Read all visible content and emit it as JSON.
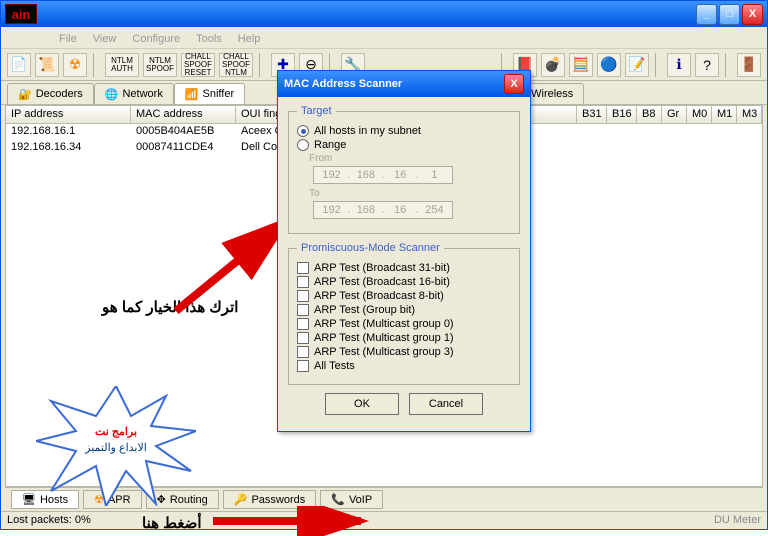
{
  "logo": "ain",
  "window_buttons": {
    "min": "_",
    "max": "□",
    "close": "X"
  },
  "menu": [
    "File",
    "View",
    "Configure",
    "Tools",
    "Help"
  ],
  "toolbar_text_btns": [
    "NTLM\nAUTH",
    "NTLM\nSPOOF",
    "CHALL\nSPOOF\nRESET",
    "CHALL\nSPOOF\nNTLM"
  ],
  "top_tabs": {
    "decoders": "Decoders",
    "network": "Network",
    "sniffer": "Sniffer",
    "wireless": "Wireless"
  },
  "columns": {
    "ip": "IP address",
    "mac": "MAC address",
    "oui": "OUI finger",
    "b31": "B31",
    "b16": "B16",
    "b8": "B8",
    "gr": "Gr",
    "m0": "M0",
    "m1": "M1",
    "m3": "M3"
  },
  "rows": [
    {
      "ip": "192.168.16.1",
      "mac": "0005B404AE5B",
      "oui": "Aceex Cor"
    },
    {
      "ip": "192.168.16.34",
      "mac": "00087411CDE4",
      "oui": "Dell Comp"
    }
  ],
  "bottom_tabs": {
    "hosts": "Hosts",
    "apr": "APR",
    "routing": "Routing",
    "passwords": "Passwords",
    "voip": "VoIP"
  },
  "status": {
    "left": "Lost packets:   0%",
    "right": "DU Meter"
  },
  "dialog": {
    "title": "MAC Address Scanner",
    "target_legend": "Target",
    "radio_all": "All hosts in my subnet",
    "radio_range": "Range",
    "from_label": "From",
    "to_label": "To",
    "ip_from": [
      "192",
      "168",
      "16",
      "1"
    ],
    "ip_to": [
      "192",
      "168",
      "16",
      "254"
    ],
    "promisc_legend": "Promiscuous-Mode Scanner",
    "checks": [
      "ARP Test (Broadcast 31-bit)",
      "ARP Test (Broadcast 16-bit)",
      "ARP Test (Broadcast 8-bit)",
      "ARP Test (Group bit)",
      "ARP Test (Multicast group 0)",
      "ARP Test (Multicast group 1)",
      "ARP Test (Multicast group 3)",
      "All Tests"
    ],
    "ok": "OK",
    "cancel": "Cancel",
    "close": "X"
  },
  "annotations": {
    "keep_option": "اترك هذا الخيار كما هو",
    "press_here": "أضغط هنا",
    "star_line1": "برامج نت",
    "star_line2": "الابداع والتميز"
  }
}
